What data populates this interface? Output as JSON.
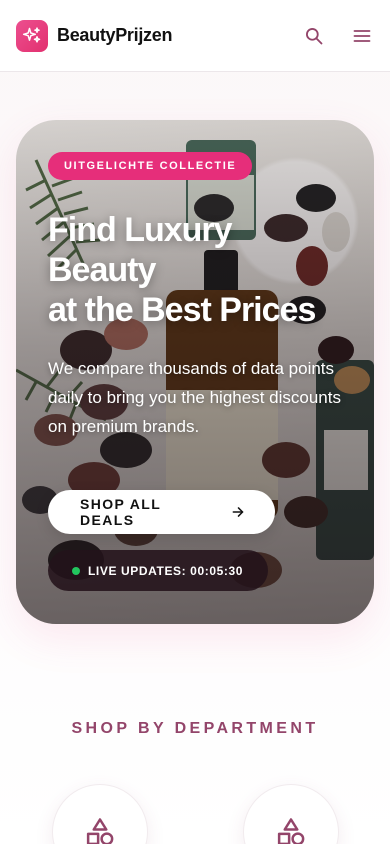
{
  "header": {
    "brand": "BeautyPrijzen",
    "logo_icon": "sparkles-icon",
    "search_icon": "search-icon",
    "menu_icon": "menu-icon"
  },
  "hero": {
    "badge": "UITGELICHTE COLLECTIE",
    "title_lines": [
      "Find Luxury",
      "Beauty",
      "at the Best Prices"
    ],
    "description": "We compare thousands of data points daily to bring you the highest discounts on premium brands.",
    "cta_label": "SHOP ALL DEALS",
    "cta_icon": "arrow-right-icon",
    "live_label": "LIVE UPDATES: 00:05:30"
  },
  "departments": {
    "title": "SHOP BY DEPARTMENT",
    "items": [
      {
        "icon": "shapes-icon"
      },
      {
        "icon": "shapes-icon"
      }
    ]
  },
  "colors": {
    "accent": "#e62e7a",
    "section_title": "#93456a",
    "live_dot": "#22c55e"
  }
}
